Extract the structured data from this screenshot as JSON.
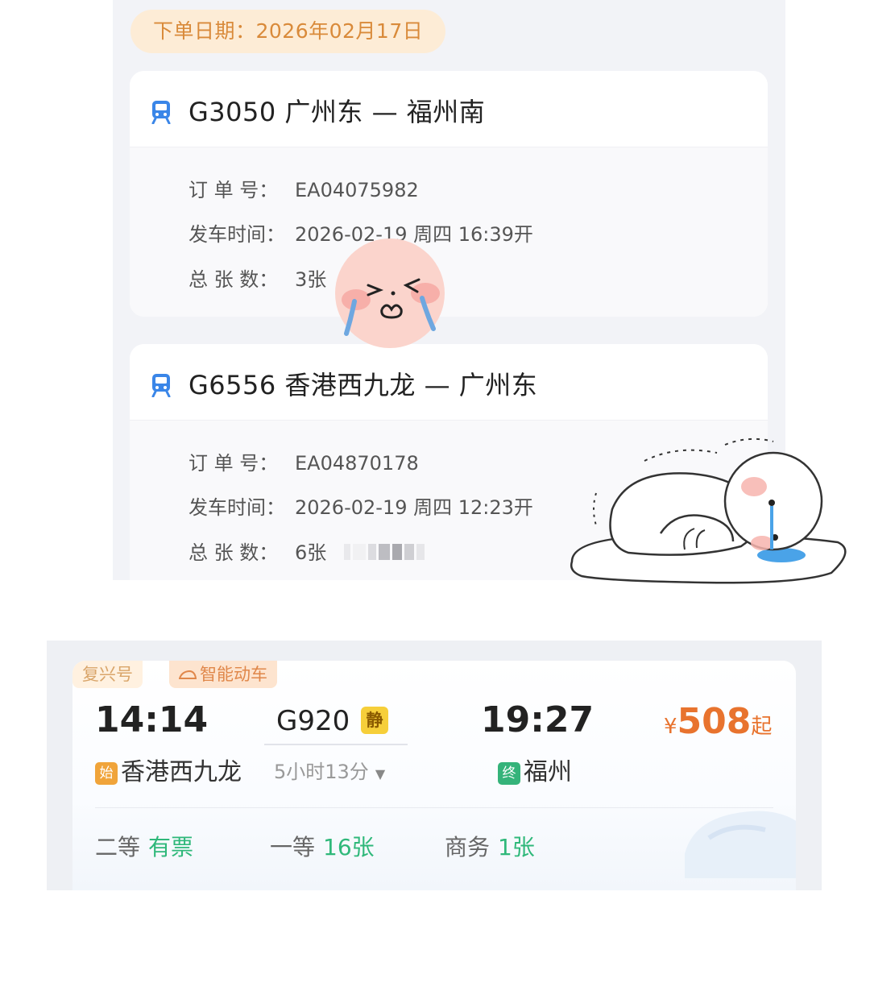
{
  "order_screen": {
    "date_label": "下单日期：2026年02月17日",
    "orders": [
      {
        "title": "G3050  广州东 — 福州南",
        "rows": [
          {
            "label": "订 单 号：",
            "value": "EA04075982"
          },
          {
            "label": "发车时间：",
            "value": "2026-02-19  周四  16:39开"
          },
          {
            "label": "总 张 数：",
            "value": "3张"
          }
        ]
      },
      {
        "title": "G6556  香港西九龙 — 广州东",
        "rows": [
          {
            "label": "订 单 号：",
            "value": "EA04870178"
          },
          {
            "label": "发车时间：",
            "value": "2026-02-19  周四  12:23开"
          },
          {
            "label": "总 张 数：",
            "value": "6张"
          }
        ]
      }
    ]
  },
  "ticket": {
    "tag_brand": "复兴号",
    "tag_smart": "智能动车",
    "depart_time": "14:14",
    "arrive_time": "19:27",
    "train_no": "G920",
    "quiet_badge": "静",
    "duration": "5小时13分",
    "from_badge": "始",
    "from_station": "香港西九龙",
    "to_badge": "终",
    "to_station": "福州",
    "price_currency": "¥",
    "price_value": "508",
    "price_suffix": "起",
    "seats": [
      {
        "class": "二等",
        "availability": "有票"
      },
      {
        "class": "一等",
        "availability": "16张"
      },
      {
        "class": "商务",
        "availability": "1张"
      }
    ]
  },
  "colors": {
    "accent_orange": "#e8732e",
    "available_green": "#2fb87a",
    "train_icon_blue": "#3a86e8"
  },
  "icons": [
    "train-icon",
    "caret-down-icon",
    "crying-face-sticker",
    "crying-lying-character-sticker"
  ]
}
